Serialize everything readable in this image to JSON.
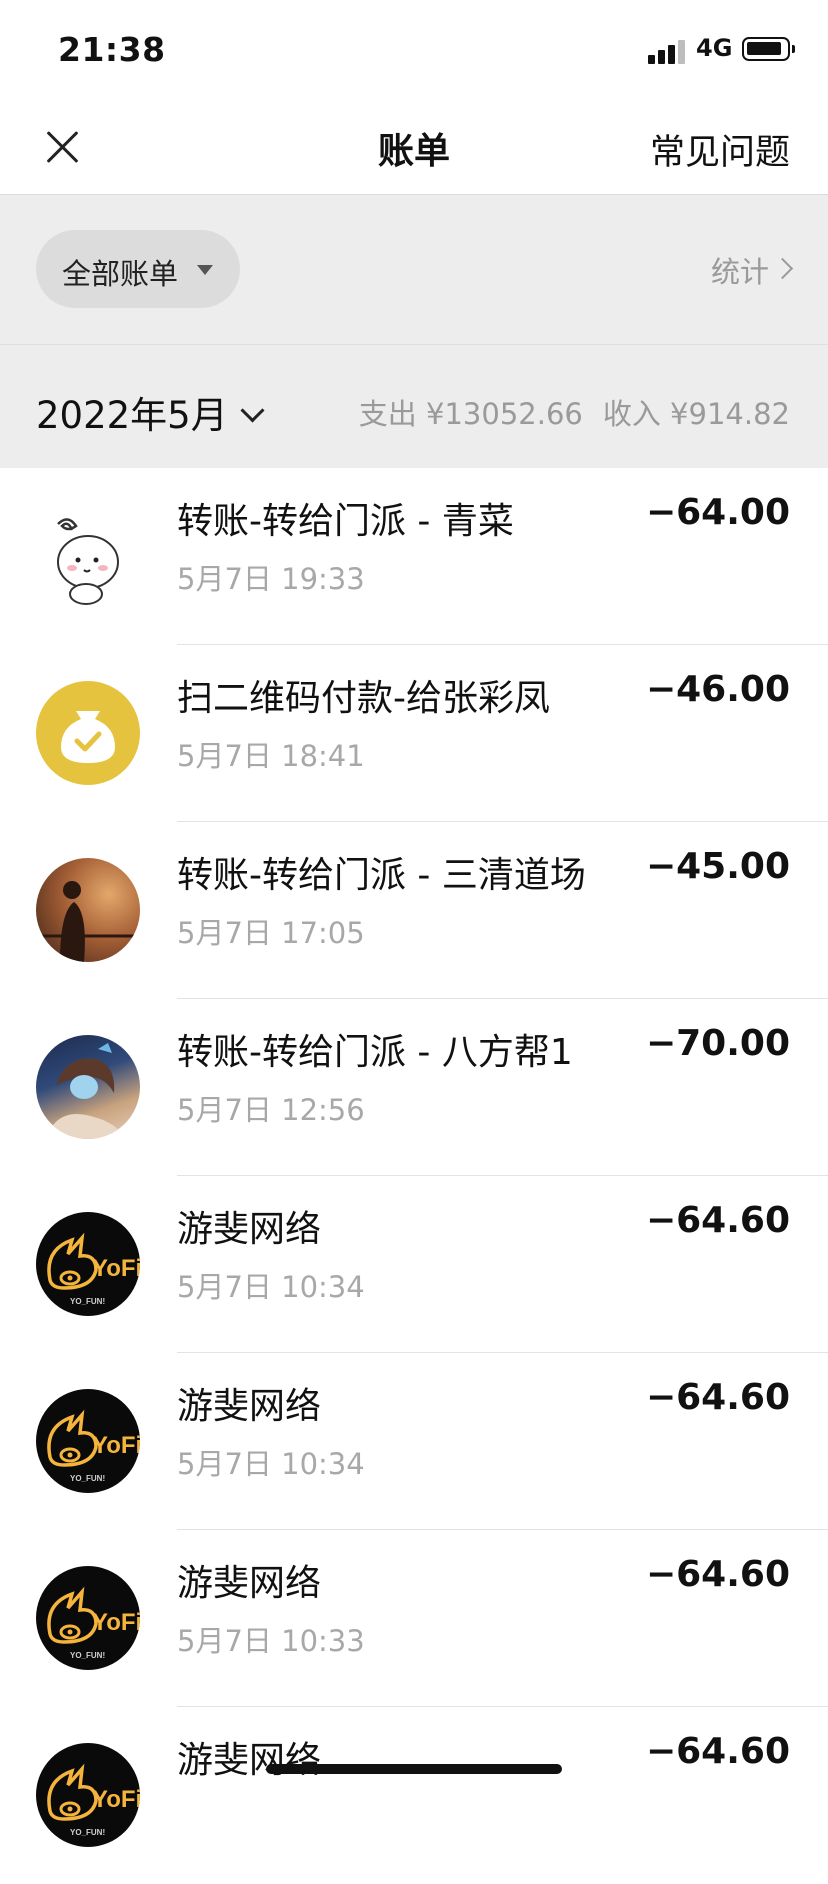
{
  "status_bar": {
    "time": "21:38",
    "network": "4G"
  },
  "nav": {
    "title": "账单",
    "faq_label": "常见问题"
  },
  "filter": {
    "label": "全部账单",
    "stats_label": "统计"
  },
  "month": {
    "label": "2022年5月",
    "expense": "支出 ¥13052.66",
    "income": "收入 ¥914.82"
  },
  "bills": [
    {
      "title": "转账-转给门派 - 青菜",
      "time": "5月7日 19:33",
      "amount": "−64.00",
      "avatar": "cartoon-avatar"
    },
    {
      "title": "扫二维码付款-给张彩凤",
      "time": "5月7日 18:41",
      "amount": "−46.00",
      "avatar": "money-bag-avatar"
    },
    {
      "title": "转账-转给门派 - 三清道场",
      "time": "5月7日 17:05",
      "amount": "−45.00",
      "avatar": "silhouette-avatar"
    },
    {
      "title": "转账-转给门派 - 八方帮1",
      "time": "5月7日 12:56",
      "amount": "−70.00",
      "avatar": "anime-avatar"
    },
    {
      "title": "游斐网络",
      "time": "5月7日 10:34",
      "amount": "−64.60",
      "avatar": "yofi-logo-avatar"
    },
    {
      "title": "游斐网络",
      "time": "5月7日 10:34",
      "amount": "−64.60",
      "avatar": "yofi-logo-avatar"
    },
    {
      "title": "游斐网络",
      "time": "5月7日 10:33",
      "amount": "−64.60",
      "avatar": "yofi-logo-avatar"
    },
    {
      "title": "游斐网络",
      "time": "",
      "amount": "−64.60",
      "avatar": "yofi-logo-avatar"
    }
  ],
  "yofi_logo_text": {
    "main": "YoFi",
    "sub": "YO_FUN!"
  }
}
